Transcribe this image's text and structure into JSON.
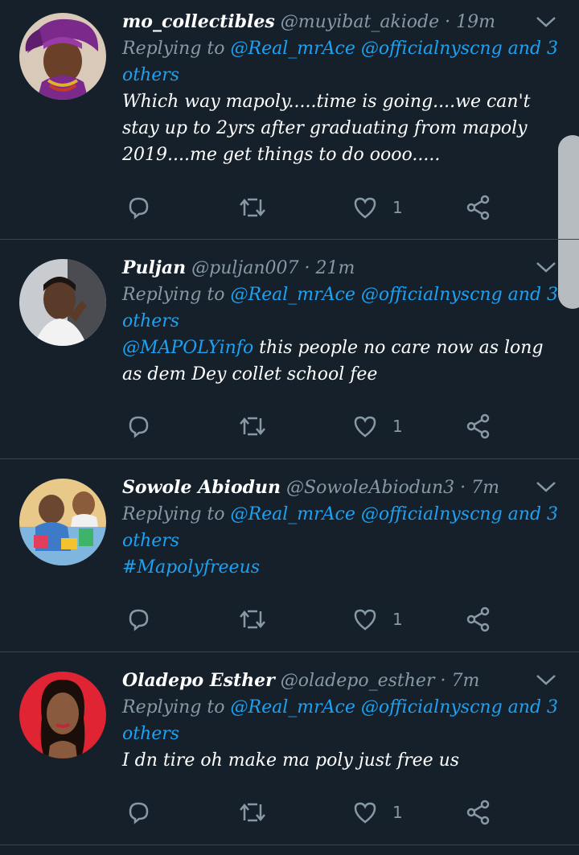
{
  "tweets": [
    {
      "name": "mo_collectibles",
      "handle": "@muyibat_akiode",
      "time": "19m",
      "replying_prefix": "Replying to",
      "replying_mentions": "@Real_mrAce @officialnyscng and 3 others",
      "body_mention": "",
      "body_text": "Which way mapoly.....time is going....we can't stay up to 2yrs after graduating from mapoly 2019....me get things to do oooo.....",
      "likes": "1",
      "avatar": "woman-in-purple-gele"
    },
    {
      "name": "Puljan",
      "handle": "@puljan007",
      "time": "21m",
      "replying_prefix": "Replying to",
      "replying_mentions": "@Real_mrAce @officialnyscng and 3 others",
      "body_mention": "@MAPOLYinfo",
      "body_text": " this people no care now as long as dem Dey collet school fee",
      "likes": "1",
      "avatar": "man-in-car"
    },
    {
      "name": "Sowole Abiodun",
      "handle": "@SowoleAbiodun3",
      "time": "7m",
      "replying_prefix": "Replying to",
      "replying_mentions": "@Real_mrAce @officialnyscng and 3 others",
      "body_mention": "#Mapolyfreeus",
      "body_text": "",
      "likes": "1",
      "avatar": "child-with-colorful-toys"
    },
    {
      "name": "Oladepo Esther",
      "handle": "@oladepo_esther",
      "time": "7m",
      "replying_prefix": "Replying to",
      "replying_mentions": "@Real_mrAce @officialnyscng and 3 others",
      "body_mention": "",
      "body_text": "I dn tire oh make ma poly just free us",
      "likes": "1",
      "avatar": "woman-portrait-red-background"
    }
  ],
  "dot": "·",
  "colors": {
    "background": "#15202b",
    "accent": "#1da1f2",
    "muted": "#8899a6",
    "divider": "#38444d"
  },
  "icons": [
    "reply-icon",
    "retweet-icon",
    "like-icon",
    "share-icon",
    "chevron-down-icon"
  ]
}
